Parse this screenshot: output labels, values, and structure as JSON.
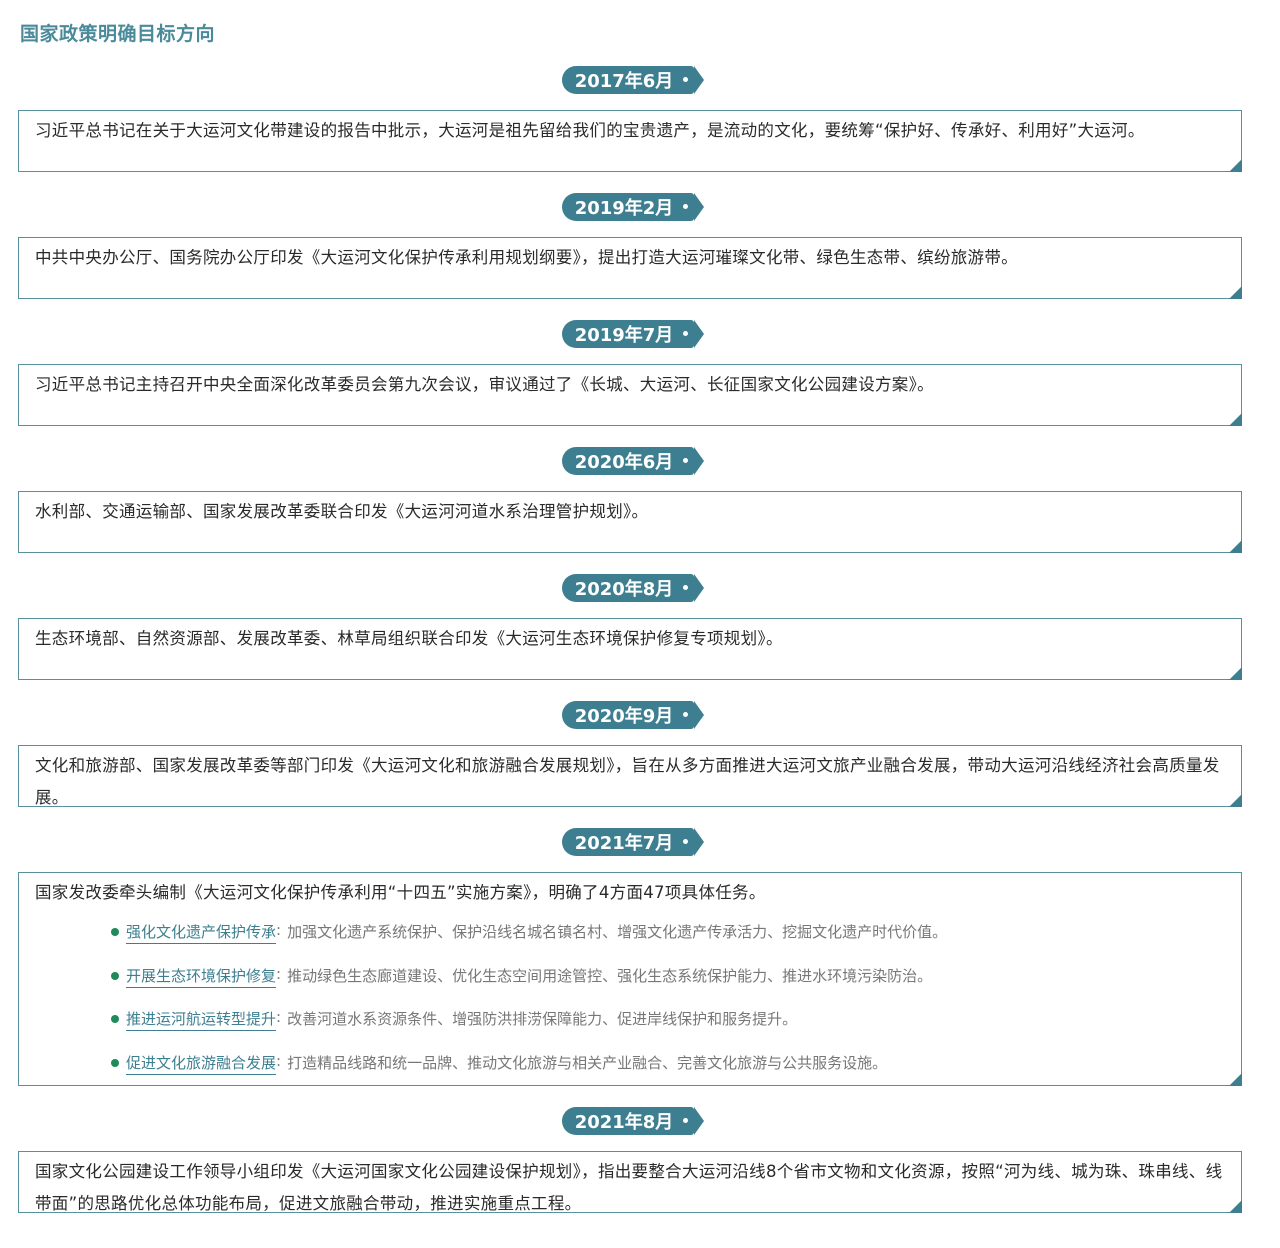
{
  "page_title": "国家政策明确目标方向",
  "entries": [
    {
      "date": "2017年6月",
      "text": "习近平总书记在关于大运河文化带建设的报告中批示，大运河是祖先留给我们的宝贵遗产，是流动的文化，要统筹“保护好、传承好、利用好”大运河。"
    },
    {
      "date": "2019年2月",
      "text": "中共中央办公厅、国务院办公厅印发《大运河文化保护传承利用规划纲要》，提出打造大运河璀璨文化带、绿色生态带、缤纷旅游带。"
    },
    {
      "date": "2019年7月",
      "text": "习近平总书记主持召开中央全面深化改革委员会第九次会议，审议通过了《长城、大运河、长征国家文化公园建设方案》。"
    },
    {
      "date": "2020年6月",
      "text": "水利部、交通运输部、国家发展改革委联合印发《大运河河道水系治理管护规划》。"
    },
    {
      "date": "2020年8月",
      "text": "生态环境部、自然资源部、发展改革委、林草局组织联合印发《大运河生态环境保护修复专项规划》。"
    },
    {
      "date": "2020年9月",
      "text": "文化和旅游部、国家发展改革委等部门印发《大运河文化和旅游融合发展规划》，旨在从多方面推进大运河文旅产业融合发展，带动大运河沿线经济社会高质量发展。"
    },
    {
      "date": "2021年7月",
      "text": "国家发改委牵头编制《大运河文化保护传承利用“十四五”实施方案》，明确了4方面47项具体任务。",
      "bullets": [
        {
          "title": "强化文化遗产保护传承",
          "sep": ":",
          "desc": "加强文化遗产系统保护、保护沿线名城名镇名村、增强文化遗产传承活力、挖掘文化遗产时代价值。"
        },
        {
          "title": "开展生态环境保护修复",
          "sep": ":",
          "desc": "推动绿色生态廊道建设、优化生态空间用途管控、强化生态系统保护能力、推进水环境污染防治。"
        },
        {
          "title": "推进运河航运转型提升",
          "sep": ":",
          "desc": "改善河道水系资源条件、增强防洪排涝保障能力、促进岸线保护和服务提升。"
        },
        {
          "title": "促进文化旅游融合发展",
          "sep": ":",
          "desc": "打造精品线路和统一品牌、推动文化旅游与相关产业融合、完善文化旅游与公共服务设施。"
        }
      ]
    },
    {
      "date": "2021年8月",
      "text": "国家文化公园建设工作领导小组印发《大运河国家文化公园建设保护规划》，指出要整合大运河沿线8个省市文物和文化资源，按照“河为线、城为珠、珠串线、线带面”的思路优化总体功能布局，促进文旅融合带动，推进实施重点工程。"
    }
  ]
}
